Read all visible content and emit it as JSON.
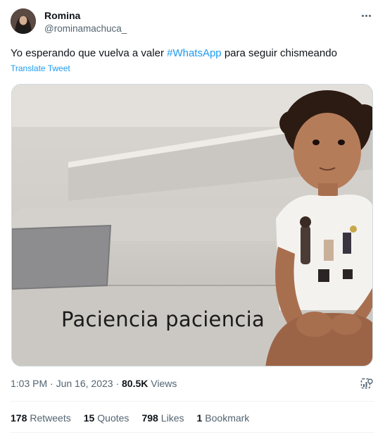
{
  "user": {
    "display_name": "Romina",
    "handle": "@rominamachuca_"
  },
  "tweet": {
    "text_before": "Yo esperando que vuelva a valer ",
    "hashtag": "#WhatsApp",
    "text_after": " para seguir chismeando",
    "translate_label": "Translate Tweet"
  },
  "media": {
    "caption": "Paciencia paciencia"
  },
  "meta": {
    "time": "1:03 PM",
    "separator": "·",
    "date": "Jun 16, 2023",
    "separator2": "·",
    "views_count": "80.5K",
    "views_label": "Views"
  },
  "stats": {
    "retweets_count": "178",
    "retweets_label": "Retweets",
    "quotes_count": "15",
    "quotes_label": "Quotes",
    "likes_count": "798",
    "likes_label": "Likes",
    "bookmarks_count": "1",
    "bookmarks_label": "Bookmark"
  },
  "icons": {
    "more": "more-dots-icon",
    "analytics": "analytics-icon"
  },
  "colors": {
    "accent": "#1d9bf0",
    "secondary_text": "#536471",
    "primary_text": "#0f1419"
  }
}
